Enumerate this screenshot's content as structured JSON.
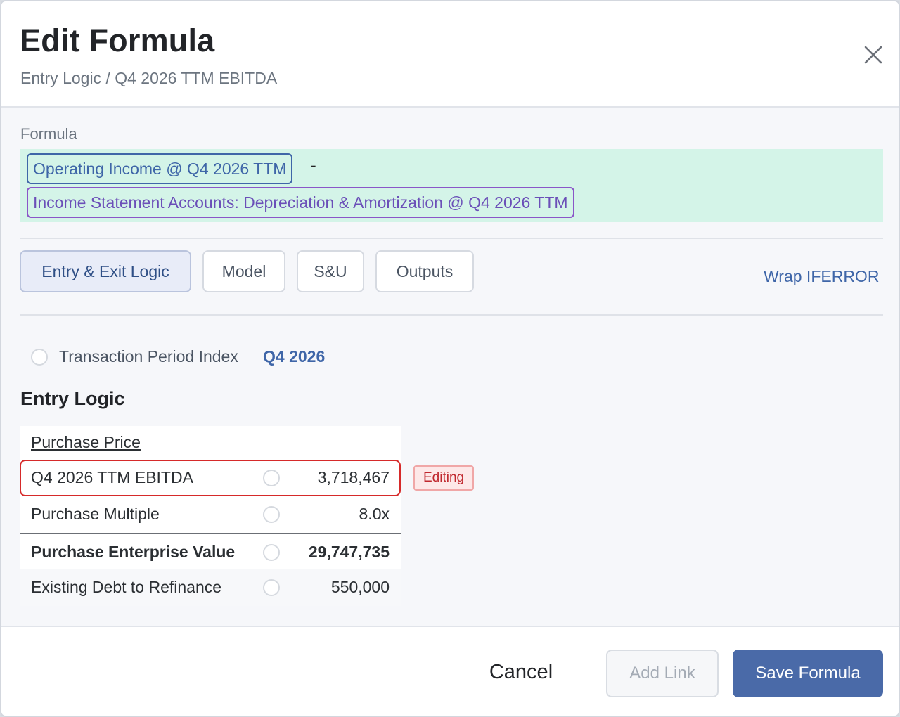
{
  "header": {
    "title": "Edit Formula",
    "breadcrumb": "Entry Logic / Q4 2026 TTM EBITDA",
    "close_icon": "close-icon"
  },
  "formula": {
    "label": "Formula",
    "tokens": [
      {
        "text": "Operating Income @ Q4 2026 TTM",
        "color": "#3f66a8"
      },
      {
        "text": "Income Statement Accounts: Depreciation & Amortization @ Q4 2026 TTM",
        "color": "#8a55c8"
      }
    ],
    "operator": "-",
    "background": "#d4f4e8"
  },
  "tabs": [
    {
      "label": "Entry & Exit Logic",
      "active": true
    },
    {
      "label": "Model",
      "active": false
    },
    {
      "label": "S&U",
      "active": false
    },
    {
      "label": "Outputs",
      "active": false
    }
  ],
  "wrap_iferror": "Wrap IFERROR",
  "period_index": {
    "label": "Transaction Period Index",
    "value": "Q4 2026"
  },
  "entry_logic": {
    "title": "Entry Logic",
    "heading": "Purchase Price",
    "rows": [
      {
        "label": "Q4 2026 TTM EBITDA",
        "value": "3,718,467",
        "state": "editing"
      },
      {
        "label": "Purchase Multiple",
        "value": "8.0x"
      },
      {
        "label": "Purchase Enterprise Value",
        "value": "29,747,735",
        "bold": true
      },
      {
        "label": "Existing Debt to Refinance",
        "value": "550,000"
      }
    ],
    "editing_badge": "Editing"
  },
  "footer": {
    "cancel_label": "Cancel",
    "add_link_label": "Add Link",
    "save_label": "Save Formula"
  },
  "colors": {
    "accent": "#4a6aa8",
    "editing_border": "#d62a2a",
    "link": "#3f66a8"
  }
}
